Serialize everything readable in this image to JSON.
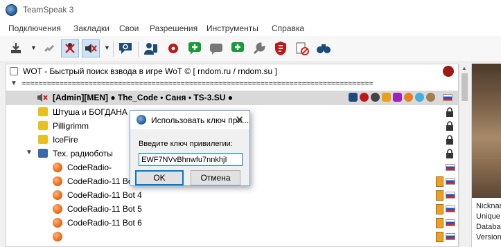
{
  "window": {
    "title": "TeamSpeak 3"
  },
  "menu": [
    "Подключения",
    "Закладки",
    "Свои",
    "Разрешения",
    "Инструменты",
    "Справка"
  ],
  "server": {
    "name": "WOT - Быстрый поиск взвода в игре WoT ©  [ rndom.ru / rndom.su ]",
    "spacer": "≈≈≈≈≈≈≈≈≈≈≈≈≈≈≈≈≈≈≈≈≈≈≈≈≈≈≈≈≈≈≈≈≈≈≈≈≈≈≈≈≈≈≈≈≈≈≈≈≈≈≈≈≈≈≈≈≈≈≈≈≈≈≈≈≈≈≈≈≈≈≈≈≈≈≈≈≈≈≈≈≈≈≈≈"
  },
  "tree": {
    "selected_user": "[Admin][MEN] ● The_Code • Саня • TS-3.SU ●",
    "channels": [
      {
        "name": "Штуша и БОГДАНА"
      },
      {
        "name": "Pilligrimm"
      },
      {
        "name": "IceFire"
      },
      {
        "name": "Тех. радиоботы"
      }
    ],
    "bots": [
      "CodeRadio-",
      "CodeRadio-11 Bot 3",
      "CodeRadio-11 Bot 4",
      "CodeRadio-11 Bot 5",
      "CodeRadio-11 Bot 6"
    ]
  },
  "info_panel": {
    "lines": [
      "Nicknar",
      "Unique",
      "Databa",
      "Version"
    ]
  },
  "dialog": {
    "title": "Использовать ключ при...",
    "label": "Введите ключ привилегии:",
    "key_value": "EWF7NVvBhnwfu7nnkhjI",
    "ok_label": "OK",
    "cancel_label": "Отмена"
  },
  "colors": {
    "accent": "#0078d7",
    "selection": "#d9d9d9",
    "channel_yellow": "#e8c020",
    "channel_blue": "#3a6aa8"
  }
}
